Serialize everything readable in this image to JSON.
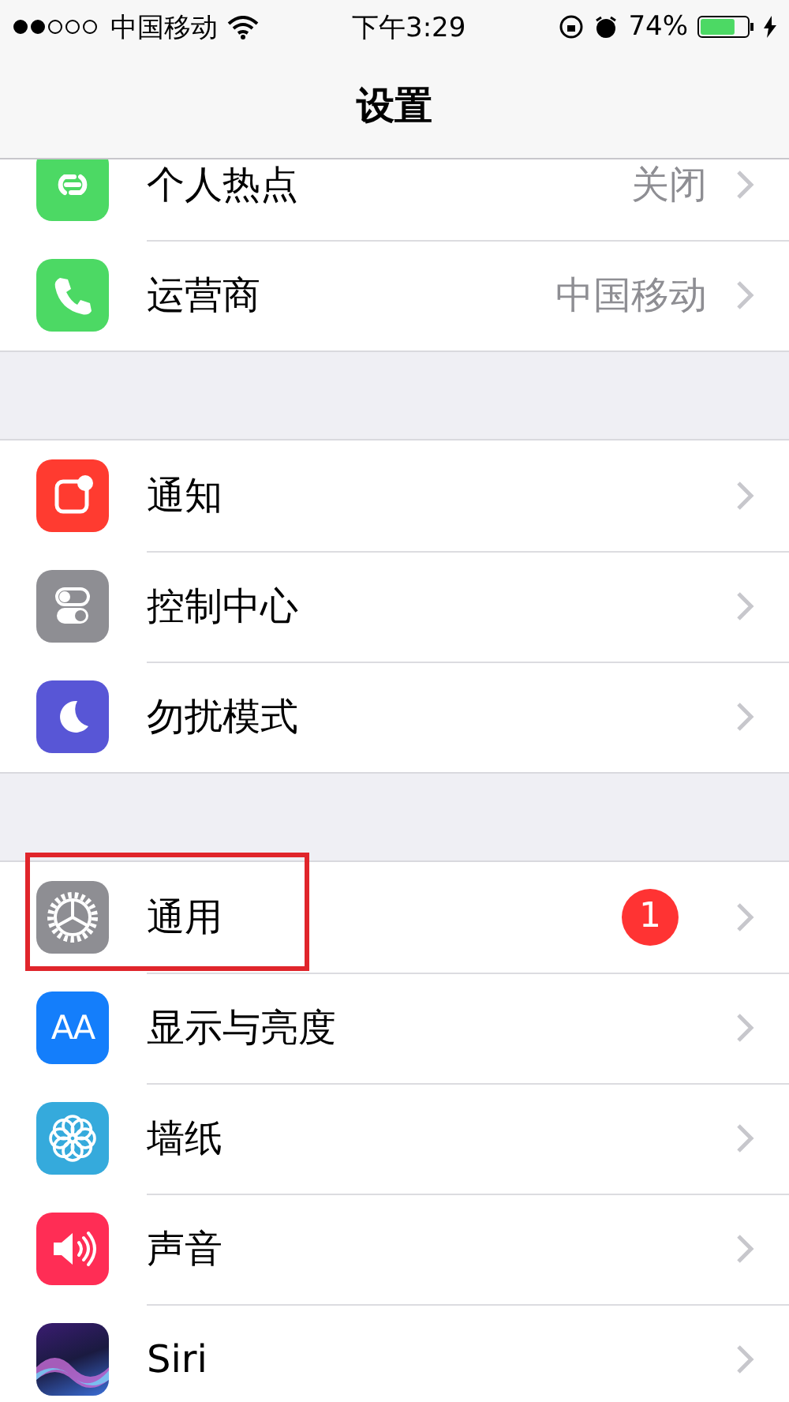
{
  "status_bar": {
    "carrier": "中国移动",
    "time": "下午3:29",
    "battery": "74%",
    "charging": true
  },
  "nav": {
    "title": "设置"
  },
  "groups": [
    {
      "items": [
        {
          "kind": "hotspot",
          "label": "个人热点",
          "value": "关闭",
          "highlighted": false
        },
        {
          "kind": "phone",
          "label": "运营商",
          "value": "中国移动",
          "highlighted": false
        }
      ]
    },
    {
      "items": [
        {
          "kind": "notifications",
          "label": "通知",
          "highlighted": false
        },
        {
          "kind": "control",
          "label": "控制中心",
          "highlighted": false
        },
        {
          "kind": "moon",
          "label": "勿扰模式",
          "highlighted": false
        }
      ]
    },
    {
      "items": [
        {
          "kind": "gear",
          "label": "通用",
          "badge": "1",
          "highlighted": true
        },
        {
          "kind": "display",
          "label": "显示与亮度",
          "icon_text": "AA",
          "highlighted": false
        },
        {
          "kind": "wallpaper",
          "label": "墙纸",
          "highlighted": false
        },
        {
          "kind": "sound",
          "label": "声音",
          "highlighted": false
        },
        {
          "kind": "siri",
          "label": "Siri",
          "highlighted": false
        }
      ]
    }
  ]
}
